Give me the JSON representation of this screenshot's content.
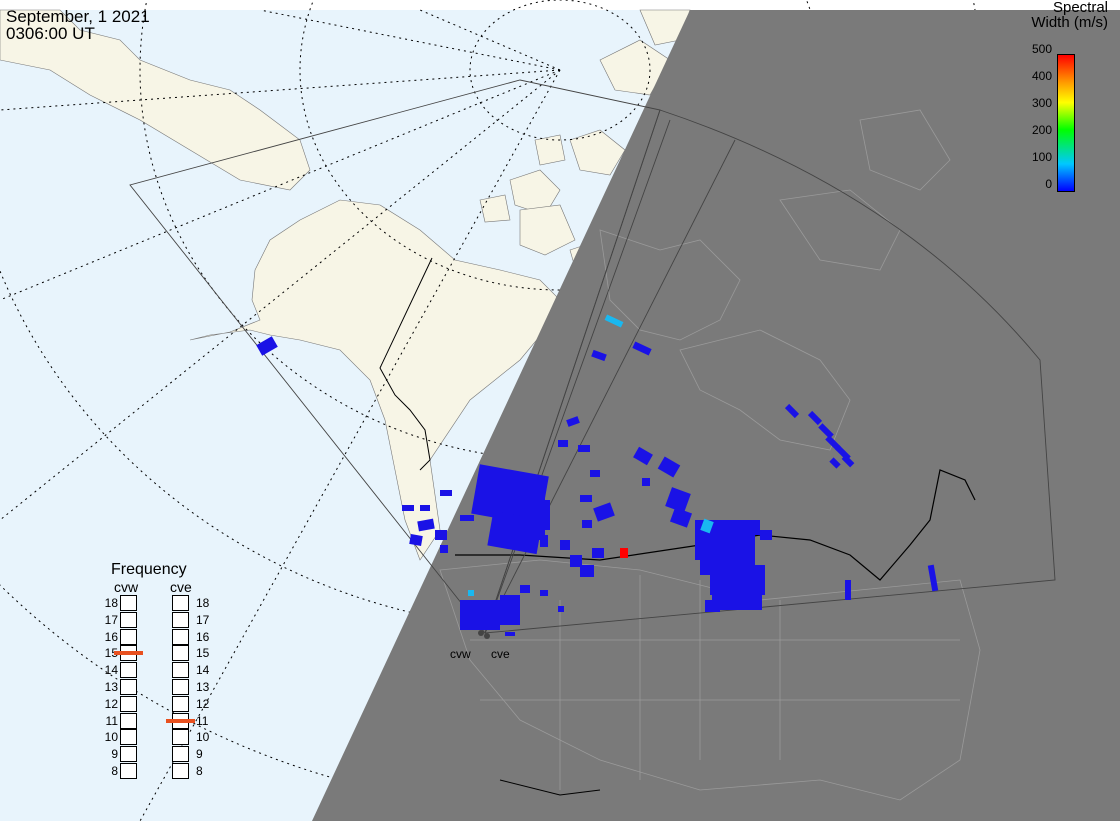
{
  "header": {
    "date": "September, 1 2021",
    "time": "0306:00 UT"
  },
  "colorbar": {
    "title_line1": "Spectral",
    "title_line2": "Width (m/s)",
    "ticks": [
      "500",
      "400",
      "300",
      "200",
      "100",
      "0"
    ],
    "range": [
      0,
      500
    ],
    "colors": [
      "#0000ff",
      "#00c8ff",
      "#00ff00",
      "#ffff00",
      "#ff9900",
      "#ff0000"
    ]
  },
  "frequency": {
    "title": "Frequency",
    "radars": [
      {
        "label": "cvw",
        "selected": "15"
      },
      {
        "label": "cve",
        "selected": "11"
      }
    ],
    "levels": [
      "18",
      "17",
      "16",
      "15",
      "14",
      "13",
      "12",
      "11",
      "10",
      "9",
      "8"
    ],
    "indicator_color": "#e8501f"
  },
  "radar_sites": {
    "cvw": "cvw",
    "cve": "cve"
  },
  "map_colors": {
    "ocean": "#e8f4fc",
    "land": "#f7f5e6",
    "night": "#7a7a7a",
    "scatter_blue": "#1a12e6",
    "scatter_cyan": "#19b8f0",
    "scatter_red": "#ff0000"
  }
}
